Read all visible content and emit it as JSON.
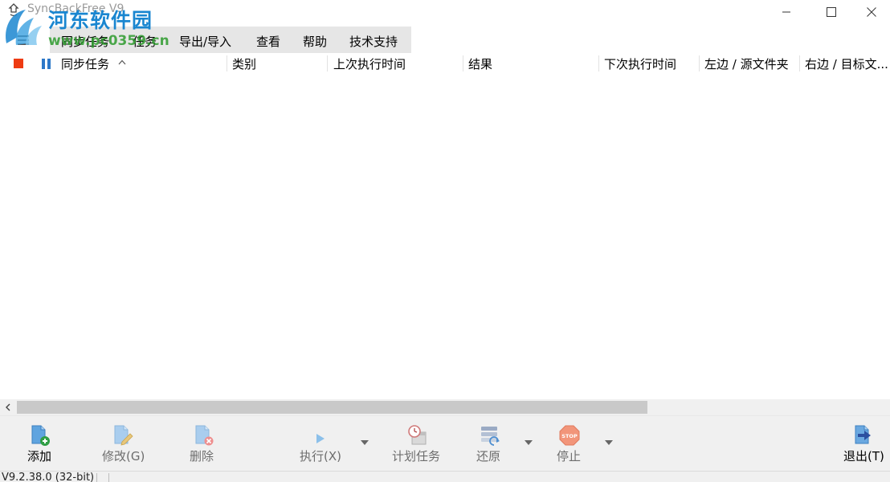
{
  "window": {
    "title": "SyncBackFree V9",
    "controls": {
      "minimize": "minimize",
      "maximize": "maximize",
      "close": "close"
    }
  },
  "watermark": {
    "name": "河东软件园",
    "url": "www.pc0359.cn"
  },
  "menu": {
    "items": [
      {
        "label": "同步任务"
      },
      {
        "label": "任务"
      },
      {
        "label": "导出/导入"
      },
      {
        "label": "查看"
      },
      {
        "label": "帮助"
      },
      {
        "label": "技术支持"
      }
    ]
  },
  "columns": [
    {
      "label": "同步任务",
      "sorted": "ascending"
    },
    {
      "label": "类别"
    },
    {
      "label": "上次执行时间"
    },
    {
      "label": "结果"
    },
    {
      "label": "下次执行时间"
    },
    {
      "label": "左边 / 源文件夹"
    },
    {
      "label": "右边 / 目标文..."
    }
  ],
  "profiles": [],
  "toolbar": {
    "add": {
      "label": "添加",
      "icon": "add-profile-icon",
      "enabled": true
    },
    "modify": {
      "label": "修改(G)",
      "icon": "edit-profile-icon",
      "enabled": false
    },
    "delete": {
      "label": "删除",
      "icon": "delete-profile-icon",
      "enabled": false
    },
    "run": {
      "label": "执行(X)",
      "icon": "play-icon",
      "enabled": false
    },
    "schedule": {
      "label": "计划任务",
      "icon": "schedule-icon",
      "enabled": false
    },
    "restore": {
      "label": "还原",
      "icon": "restore-icon",
      "enabled": false
    },
    "stop": {
      "label": "停止",
      "icon": "stop-sign-icon",
      "enabled": false
    },
    "exit": {
      "label": "退出(T)",
      "icon": "exit-icon",
      "enabled": true
    }
  },
  "status": {
    "version": "V9.2.38.0 (32-bit)"
  },
  "colors": {
    "stop_red": "#ee3b12",
    "pause_blue": "#2d78c8",
    "watermark_blue": "#1a86d0",
    "watermark_green": "#2e9b2e"
  }
}
